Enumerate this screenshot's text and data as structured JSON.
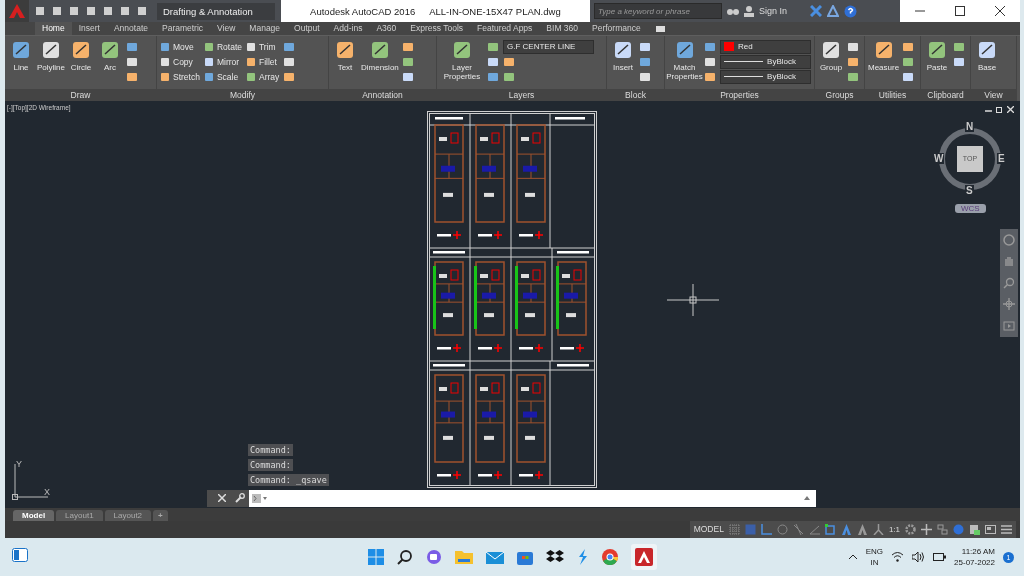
{
  "quick_access": {
    "workspace": "Drafting & Annotation"
  },
  "title": {
    "app": "Autodesk AutoCAD 2016",
    "file": "ALL-IN-ONE-15X47 PLAN.dwg"
  },
  "search": {
    "placeholder": "Type a keyword or phrase"
  },
  "account": {
    "label": "Sign In"
  },
  "ribbon_tabs": [
    {
      "label": "Home",
      "selected": true
    },
    {
      "label": "Insert",
      "selected": false
    },
    {
      "label": "Annotate",
      "selected": false
    },
    {
      "label": "Parametric",
      "selected": false
    },
    {
      "label": "View",
      "selected": false
    },
    {
      "label": "Manage",
      "selected": false
    },
    {
      "label": "Output",
      "selected": false
    },
    {
      "label": "Add-ins",
      "selected": false
    },
    {
      "label": "A360",
      "selected": false
    },
    {
      "label": "Express Tools",
      "selected": false
    },
    {
      "label": "Featured Apps",
      "selected": false
    },
    {
      "label": "BIM 360",
      "selected": false
    },
    {
      "label": "Performance",
      "selected": false
    }
  ],
  "ribbon_panels": [
    {
      "title": "Draw",
      "tools": [
        {
          "kind": "large",
          "label": "Line"
        },
        {
          "kind": "large",
          "label": "Polyline"
        },
        {
          "kind": "large",
          "label": "Circle"
        },
        {
          "kind": "large",
          "label": "Arc"
        },
        {
          "kind": "icon"
        },
        {
          "kind": "icon"
        },
        {
          "kind": "icon"
        }
      ]
    },
    {
      "title": "Modify",
      "tools": [
        {
          "kind": "small",
          "label": "Move"
        },
        {
          "kind": "small",
          "label": "Copy"
        },
        {
          "kind": "small",
          "label": "Stretch"
        },
        {
          "kind": "small",
          "label": "Rotate"
        },
        {
          "kind": "small",
          "label": "Mirror"
        },
        {
          "kind": "small",
          "label": "Scale"
        },
        {
          "kind": "small",
          "label": "Trim"
        },
        {
          "kind": "small",
          "label": "Fillet"
        },
        {
          "kind": "small",
          "label": "Array"
        },
        {
          "kind": "icon"
        },
        {
          "kind": "icon"
        },
        {
          "kind": "icon"
        }
      ]
    },
    {
      "title": "Annotation",
      "tools": [
        {
          "kind": "large",
          "label": "Text"
        },
        {
          "kind": "large",
          "label": "Dimension"
        },
        {
          "kind": "icon"
        },
        {
          "kind": "icon"
        },
        {
          "kind": "icon"
        }
      ]
    },
    {
      "title": "Layers",
      "tools": [
        {
          "kind": "large",
          "label": "Layer Properties"
        },
        {
          "kind": "icon"
        },
        {
          "kind": "icon"
        },
        {
          "kind": "icon"
        },
        {
          "kind": "dropdown",
          "value": "G.F CENTER LINE"
        },
        {
          "kind": "icon"
        },
        {
          "kind": "icon"
        }
      ]
    },
    {
      "title": "Block",
      "tools": [
        {
          "kind": "large",
          "label": "Insert"
        },
        {
          "kind": "icon"
        },
        {
          "kind": "icon"
        },
        {
          "kind": "icon"
        }
      ]
    },
    {
      "title": "Properties",
      "tools": [
        {
          "kind": "large",
          "label": "Match Properties"
        },
        {
          "kind": "icon"
        },
        {
          "kind": "icon"
        },
        {
          "kind": "icon"
        },
        {
          "kind": "dropdown",
          "value": "Red",
          "color": "#ff0000"
        },
        {
          "kind": "linetype",
          "value": "ByBlock"
        },
        {
          "kind": "linetype",
          "value": "ByBlock"
        }
      ]
    },
    {
      "title": "Groups",
      "tools": [
        {
          "kind": "large",
          "label": "Group"
        },
        {
          "kind": "icon"
        },
        {
          "kind": "icon"
        },
        {
          "kind": "icon"
        }
      ]
    },
    {
      "title": "Utilities",
      "tools": [
        {
          "kind": "large",
          "label": "Measure"
        },
        {
          "kind": "icon"
        },
        {
          "kind": "icon"
        },
        {
          "kind": "icon"
        }
      ]
    },
    {
      "title": "Clipboard",
      "tools": [
        {
          "kind": "large",
          "label": "Paste"
        },
        {
          "kind": "icon"
        },
        {
          "kind": "icon"
        }
      ]
    },
    {
      "title": "View",
      "tools": [
        {
          "kind": "large",
          "label": "Base"
        }
      ]
    }
  ],
  "viewport": {
    "label": "[-][Top][2D Wireframe]",
    "north": "N",
    "east": "E",
    "south": "S",
    "west": "W",
    "face": "TOP",
    "ucs_menu": "WCS",
    "axis_x": "X",
    "axis_y": "Y"
  },
  "command_history": [
    "Command:",
    "Command:",
    "Command: _qsave"
  ],
  "layout_tabs": [
    {
      "label": "Model",
      "selected": true
    },
    {
      "label": "Layout1",
      "selected": false
    },
    {
      "label": "Layout2",
      "selected": false
    }
  ],
  "new_layout": "+",
  "status_bar": {
    "mode": "MODEL",
    "scale": "1:1"
  },
  "taskbar": {
    "language": "ENG",
    "region": "IN",
    "time": "11:26 AM",
    "date": "25-07-2022",
    "notifications": "1"
  }
}
